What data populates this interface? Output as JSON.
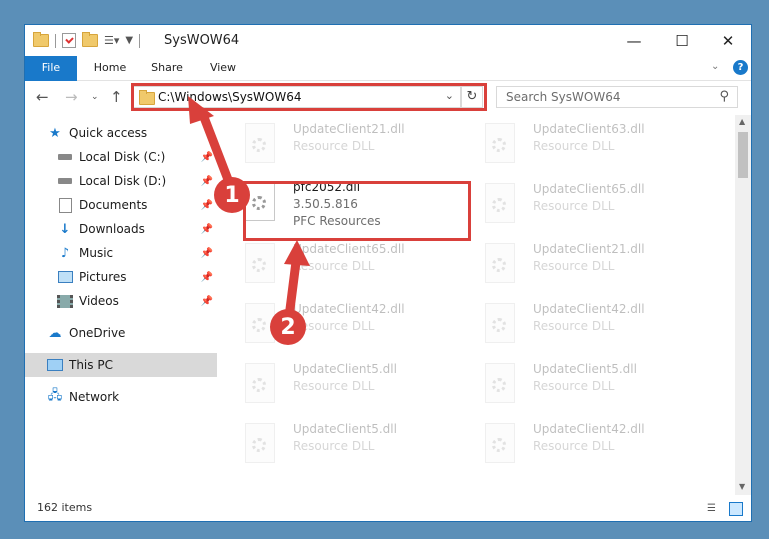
{
  "window": {
    "title": "SysWOW64"
  },
  "ribbon": {
    "tabs": [
      "File",
      "Home",
      "Share",
      "View"
    ]
  },
  "address": {
    "path": "C:\\Windows\\SysWOW64"
  },
  "search": {
    "placeholder": "Search SysWOW64"
  },
  "sidebar": {
    "items": [
      {
        "label": "Quick access"
      },
      {
        "label": "Local Disk (C:)"
      },
      {
        "label": "Local Disk (D:)"
      },
      {
        "label": "Documents"
      },
      {
        "label": "Downloads"
      },
      {
        "label": "Music"
      },
      {
        "label": "Pictures"
      },
      {
        "label": "Videos"
      },
      {
        "label": "OneDrive"
      },
      {
        "label": "This PC"
      },
      {
        "label": "Network"
      }
    ]
  },
  "files": {
    "highlighted": {
      "name": "pfc2052.dll",
      "version": "3.50.5.816",
      "desc": "PFC Resources"
    },
    "background": [
      {
        "name": "UpdateClient21.dll",
        "desc": "Resource DLL"
      },
      {
        "name": "UpdateClient63.dll",
        "desc": "Resource DLL"
      },
      {
        "name": "UpdateClient65.dll",
        "desc": "Resource DLL"
      },
      {
        "name": "UpdateClient65.dll",
        "desc": "Resource DLL"
      },
      {
        "name": "UpdateClient21.dll",
        "desc": "Resource DLL"
      },
      {
        "name": "UpdateClient42.dll",
        "desc": "Resource DLL"
      },
      {
        "name": "UpdateClient42.dll",
        "desc": "Resource DLL"
      },
      {
        "name": "UpdateClient5.dll",
        "desc": "Resource DLL"
      },
      {
        "name": "UpdateClient5.dll",
        "desc": "Resource DLL"
      },
      {
        "name": "UpdateClient5.dll",
        "desc": "Resource DLL"
      },
      {
        "name": "UpdateClient42.dll",
        "desc": "Resource DLL"
      }
    ]
  },
  "status": {
    "count": "162 items"
  },
  "annotations": {
    "badge1": "1",
    "badge2": "2"
  },
  "colors": {
    "accent": "#1979ca",
    "highlight": "#d9403b"
  }
}
